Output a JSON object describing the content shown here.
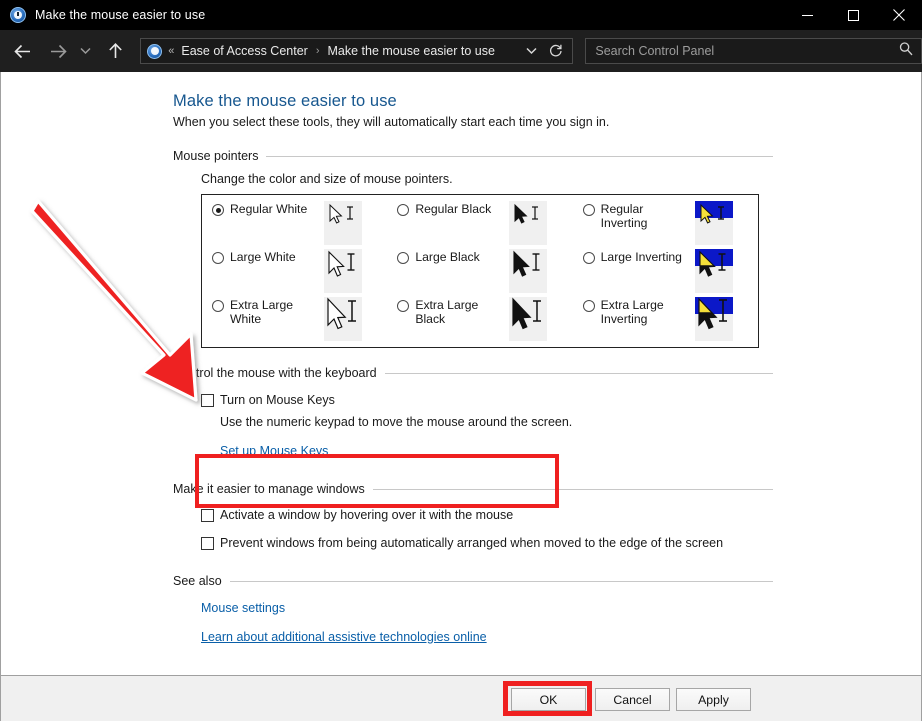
{
  "window": {
    "title": "Make the mouse easier to use",
    "app_icon": "ease-of-access-icon",
    "minimize_label": "Minimize",
    "maximize_label": "Maximize",
    "close_label": "Close"
  },
  "nav": {
    "back_label": "Back",
    "forward_label": "Forward",
    "recent_label": "Recent locations",
    "up_label": "Up one level",
    "breadcrumb": {
      "overflow": "«",
      "items": [
        "Ease of Access Center",
        "Make the mouse easier to use"
      ],
      "separator": "›"
    },
    "refresh_label": "Refresh",
    "dropdown_label": "Previous locations"
  },
  "search": {
    "placeholder": "Search Control Panel",
    "icon": "search-icon"
  },
  "main": {
    "title": "Make the mouse easier to use",
    "subtitle": "When you select these tools, they will automatically start each time you sign in.",
    "sections": {
      "pointers": {
        "header": "Mouse pointers",
        "hint": "Change the color and size of mouse pointers.",
        "options": [
          {
            "label": "Regular White",
            "selected": true,
            "style": "white"
          },
          {
            "label": "Large White",
            "selected": false,
            "style": "white"
          },
          {
            "label": "Extra Large White",
            "selected": false,
            "style": "white"
          },
          {
            "label": "Regular Black",
            "selected": false,
            "style": "black"
          },
          {
            "label": "Large Black",
            "selected": false,
            "style": "black"
          },
          {
            "label": "Extra Large Black",
            "selected": false,
            "style": "black"
          },
          {
            "label": "Regular Inverting",
            "selected": false,
            "style": "inverting"
          },
          {
            "label": "Large Inverting",
            "selected": false,
            "style": "inverting"
          },
          {
            "label": "Extra Large Inverting",
            "selected": false,
            "style": "inverting"
          }
        ]
      },
      "keyboard": {
        "header": "Control the mouse with the keyboard",
        "checkbox_label": "Turn on Mouse Keys",
        "checkbox_checked": false,
        "description": "Use the numeric keypad to move the mouse around the screen.",
        "link": "Set up Mouse Keys"
      },
      "windows": {
        "header": "Make it easier to manage windows",
        "items": [
          {
            "label": "Activate a window by hovering over it with the mouse",
            "checked": false
          },
          {
            "label": "Prevent windows from being automatically arranged when moved to the edge of the screen",
            "checked": false
          }
        ]
      },
      "see_also": {
        "header": "See also",
        "links": [
          {
            "label": "Mouse settings",
            "underline": false
          },
          {
            "label": "Learn about additional assistive technologies online",
            "underline": true
          }
        ]
      }
    }
  },
  "footer": {
    "ok": "OK",
    "cancel": "Cancel",
    "apply": "Apply"
  },
  "annotations": {
    "arrow_color": "#ee2222",
    "highlight_color": "#ef2020",
    "arrow_target": "Turn on Mouse Keys checkbox",
    "highlighted_button": "OK"
  }
}
